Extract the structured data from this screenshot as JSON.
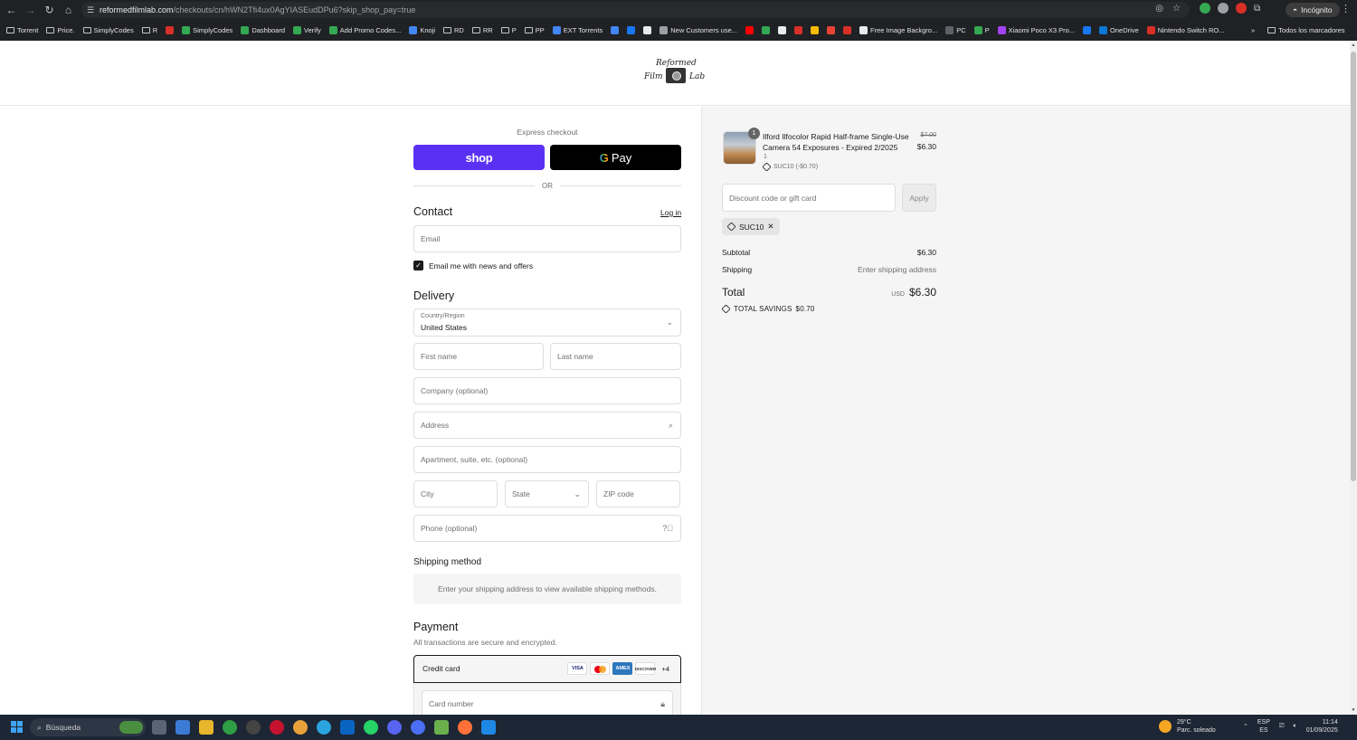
{
  "browser": {
    "url_host": "reformedfilmlab.com",
    "url_rest": "/checkouts/cn/hWN2Tfi4ux0AgYIASEudDPu6?skip_shop_pay=true",
    "incognito_label": "Incógnito",
    "bookmarks": [
      {
        "label": "Torrent",
        "icon": "folder-icon"
      },
      {
        "label": "Price.",
        "icon": "folder-icon"
      },
      {
        "label": "SimplyCodes",
        "icon": "folder-icon"
      },
      {
        "label": "R",
        "icon": "folder-icon"
      },
      {
        "label": "",
        "icon": "site-icon-red"
      },
      {
        "label": "SimplyCodes",
        "icon": "site-icon-green"
      },
      {
        "label": "Dashboard",
        "icon": "site-icon-green"
      },
      {
        "label": "Verify",
        "icon": "site-icon-green"
      },
      {
        "label": "Add Promo Codes...",
        "icon": "site-icon-green"
      },
      {
        "label": "Knoji",
        "icon": "site-icon-blue"
      },
      {
        "label": "RD",
        "icon": "folder-icon"
      },
      {
        "label": "RR",
        "icon": "folder-icon"
      },
      {
        "label": "P",
        "icon": "folder-icon"
      },
      {
        "label": "PP",
        "icon": "folder-icon"
      },
      {
        "label": "EXT Torrents",
        "icon": "site-icon-blue"
      },
      {
        "label": "",
        "icon": "site-icon-blue"
      },
      {
        "label": "",
        "icon": "facebook-icon"
      },
      {
        "label": "",
        "icon": "x-icon"
      },
      {
        "label": "New Customers use...",
        "icon": "globe-icon"
      },
      {
        "label": "",
        "icon": "youtube-icon"
      },
      {
        "label": "",
        "icon": "site-icon-green"
      },
      {
        "label": "",
        "icon": "site-icon-white"
      },
      {
        "label": "",
        "icon": "site-icon-red"
      },
      {
        "label": "",
        "icon": "site-icon-yellow"
      },
      {
        "label": "",
        "icon": "gmail-icon"
      },
      {
        "label": "",
        "icon": "site-icon-red"
      },
      {
        "label": "Free Image Backgro...",
        "icon": "site-icon-white"
      },
      {
        "label": "PC",
        "icon": "site-icon-dark"
      },
      {
        "label": "P",
        "icon": "site-icon-green"
      },
      {
        "label": "Xiaomi Poco X3 Pro...",
        "icon": "site-icon-purple"
      },
      {
        "label": "",
        "icon": "facebook-icon"
      },
      {
        "label": "OneDrive",
        "icon": "onedrive-icon"
      },
      {
        "label": "Nintendo Switch RO...",
        "icon": "site-icon-red"
      }
    ],
    "bookmarks_more": "»",
    "all_bookmarks": "Todos los marcadores"
  },
  "store": {
    "logo_line1": "Reformed",
    "logo_line2": "Film",
    "logo_line3": "Lab"
  },
  "checkout": {
    "express_label": "Express checkout",
    "shop_button": "shop",
    "gpay_g": "G",
    "gpay_label": "Pay",
    "or_label": "OR",
    "contact_heading": "Contact",
    "login_link": "Log in",
    "email_placeholder": "Email",
    "news_checkbox_label": "Email me with news and offers",
    "delivery_heading": "Delivery",
    "country_label": "Country/Region",
    "country_value": "United States",
    "first_name": "First name",
    "last_name": "Last name",
    "company": "Company (optional)",
    "address": "Address",
    "apartment": "Apartment, suite, etc. (optional)",
    "city": "City",
    "state": "State",
    "zip": "ZIP code",
    "phone": "Phone (optional)",
    "shipping_method_heading": "Shipping method",
    "shipping_method_note": "Enter your shipping address to view available shipping methods.",
    "payment_heading": "Payment",
    "payment_sub": "All transactions are secure and encrypted.",
    "credit_card_label": "Credit card",
    "card_brands": [
      "VISA",
      "",
      "AMEX",
      "DISCOVER"
    ],
    "card_more": "+4",
    "card_number_placeholder": "Card number"
  },
  "summary": {
    "product_qty_badge": "1",
    "product_name": "Ilford Ilfocolor Rapid Half-frame Single-Use Camera 54 Exposures - Expired 2/2025",
    "product_qty": "1",
    "product_discount": "SUC10 (-$0.70)",
    "price_original": "$7.00",
    "price_current": "$6.30",
    "discount_placeholder": "Discount code or gift card",
    "apply_label": "Apply",
    "applied_code": "SUC10",
    "subtotal_label": "Subtotal",
    "subtotal_value": "$6.30",
    "shipping_label": "Shipping",
    "shipping_value": "Enter shipping address",
    "total_label": "Total",
    "currency": "USD",
    "total_value": "$6.30",
    "savings_label": "TOTAL SAVINGS",
    "savings_value": "$0.70"
  },
  "taskbar": {
    "search_label": "Búsqueda",
    "weather_temp": "29°C",
    "weather_desc": "Parc. soleado",
    "lang_1": "ESP",
    "lang_2": "ES",
    "time": "11:14",
    "date": "01/09/2025"
  },
  "colors": {
    "shop_purple": "#5a31f4",
    "gpay_black": "#000000",
    "summary_bg": "#f5f5f5",
    "chrome_dark": "#202124",
    "taskbar": "#1c2634"
  }
}
